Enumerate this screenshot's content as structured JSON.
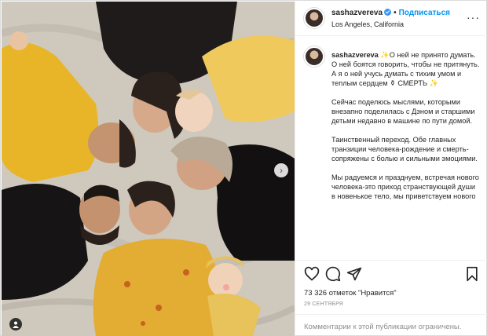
{
  "header": {
    "username": "sashazvereva",
    "separator": "•",
    "follow_label": "Подписаться",
    "location": "Los Angeles, California",
    "more_icon": "more-horizontal-icon"
  },
  "caption": {
    "username": "sashazvereva",
    "paragraphs": [
      "✨О ней не принято думать. О ней боятся говорить, чтобы не притянуть. А я о ней учусь думать с тихим умом и теплым сердцем ⚱ СМЕРТЬ ✨",
      "Сейчас поделюсь мыслями, которыми внезапно поделилась с Дэном и старшими детьми недавно в машине по пути домой.",
      "Таинственный переход. Обе главных транзиции человека-рождение и смерть-сопряжены с болью и сильными эмоциями.",
      "Мы радуемся и празднуем, встречая нового человека-это приход странствующей души в новенькое тело, мы приветствуем нового"
    ]
  },
  "actions": {
    "like_icon": "heart-icon",
    "comment_icon": "comment-icon",
    "share_icon": "share-icon",
    "save_icon": "bookmark-icon"
  },
  "likes_text": "73 326 отметок \"Нравится\"",
  "date_text": "29 СЕНТЯБРЯ",
  "comments_disabled_text": "Комментарии к этой публикации ограничены.",
  "photo": {
    "next_icon": "chevron-right-icon",
    "tag_icon": "user-tag-icon"
  },
  "colors": {
    "accent": "#0095f6",
    "verified": "#3897f0",
    "muted": "#8e8e8e",
    "border": "#dbdbdb"
  }
}
